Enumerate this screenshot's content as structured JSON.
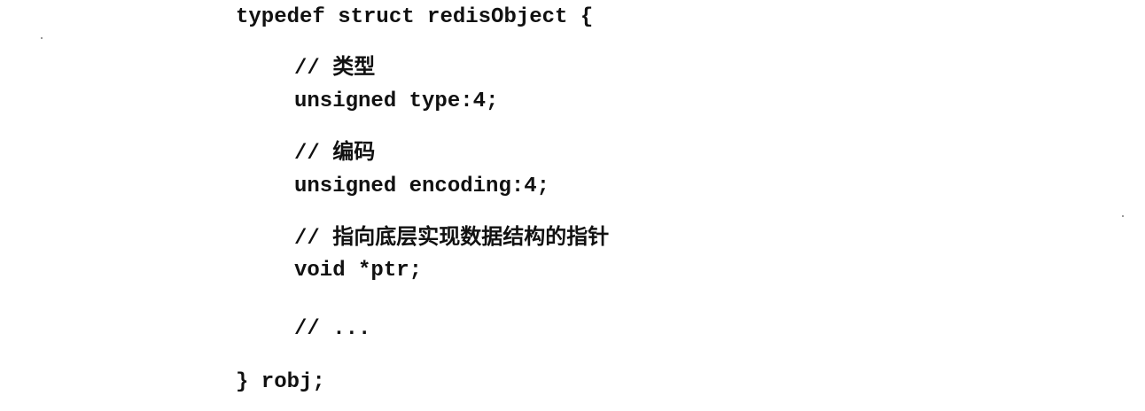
{
  "code": {
    "lines": [
      "typedef struct redisObject {",
      "// 类型",
      "unsigned type:4;",
      "// 编码",
      "unsigned encoding:4;",
      "// 指向底层实现数据结构的指针",
      "void *ptr;",
      "// ...",
      "} robj;"
    ]
  }
}
